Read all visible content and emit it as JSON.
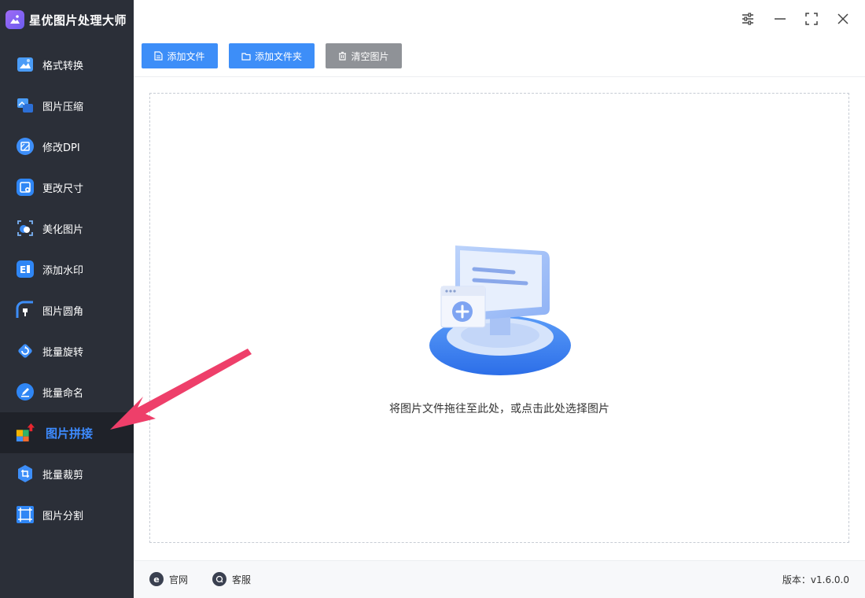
{
  "app": {
    "title": "星优图片处理大师"
  },
  "sidebar": {
    "items": [
      {
        "label": "格式转换",
        "icon": "format-convert-icon"
      },
      {
        "label": "图片压缩",
        "icon": "compress-icon"
      },
      {
        "label": "修改DPI",
        "icon": "dpi-icon"
      },
      {
        "label": "更改尺寸",
        "icon": "resize-icon"
      },
      {
        "label": "美化图片",
        "icon": "beautify-icon"
      },
      {
        "label": "添加水印",
        "icon": "watermark-icon"
      },
      {
        "label": "图片圆角",
        "icon": "round-corner-icon"
      },
      {
        "label": "批量旋转",
        "icon": "rotate-icon"
      },
      {
        "label": "批量命名",
        "icon": "rename-icon"
      },
      {
        "label": "图片拼接",
        "icon": "stitch-icon",
        "active": true
      },
      {
        "label": "批量裁剪",
        "icon": "crop-icon"
      },
      {
        "label": "图片分割",
        "icon": "split-icon"
      }
    ]
  },
  "toolbar": {
    "add_file": "添加文件",
    "add_folder": "添加文件夹",
    "clear_images": "清空图片"
  },
  "dropzone": {
    "hint": "将图片文件拖往至此处，或点击此处选择图片"
  },
  "footer": {
    "website": "官网",
    "support": "客服",
    "version": "版本：v1.6.0.0"
  },
  "colors": {
    "accent": "#3d8ef8",
    "sidebar_bg": "#2b2f38",
    "active_text": "#3d8bff"
  }
}
